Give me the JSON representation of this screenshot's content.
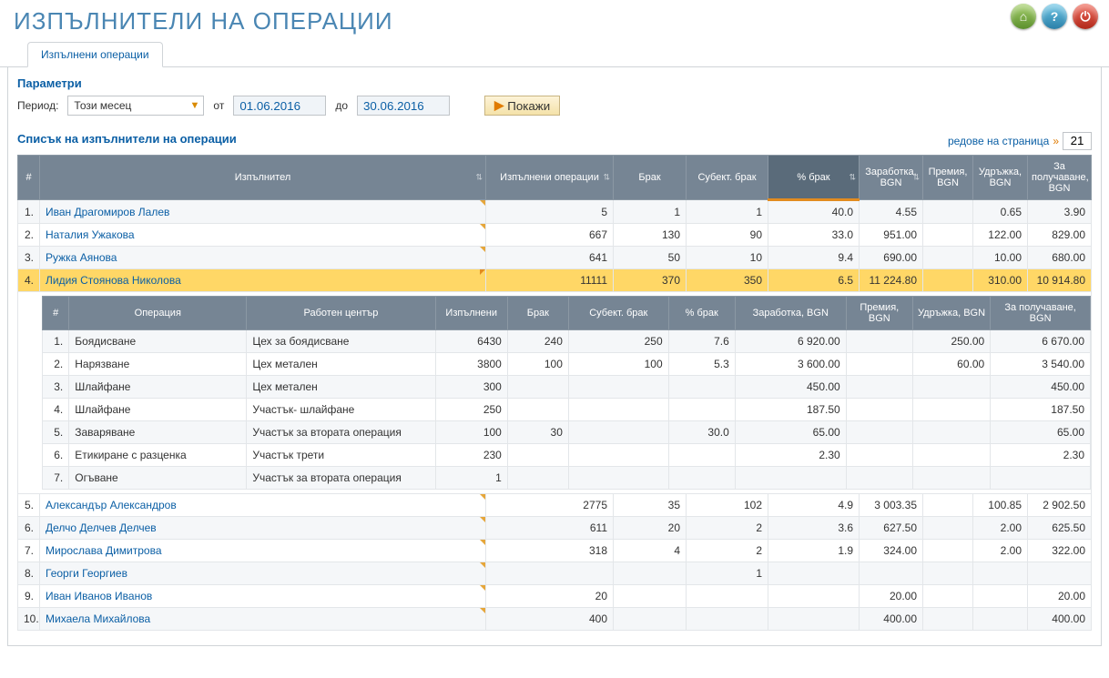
{
  "header": {
    "title": "ИЗПЪЛНИТЕЛИ НА ОПЕРАЦИИ",
    "tab": "Изпълнени операции"
  },
  "params": {
    "section_title": "Параметри",
    "period_label": "Период:",
    "period_value": "Този месец",
    "from_label": "от",
    "from_value": "01.06.2016",
    "to_label": "до",
    "to_value": "30.06.2016",
    "show_label": "Покажи"
  },
  "list": {
    "title": "Списък на изпълнители на операции",
    "rpp_label": "редове на страница",
    "rpp_value": "21"
  },
  "columns": {
    "idx": "#",
    "performer": "Изпълнител",
    "done": "Изпълнени операции",
    "scrap": "Брак",
    "subj_scrap": "Субект. брак",
    "pct_scrap": "% брак",
    "earn": "Заработка, BGN",
    "bonus": "Премия, BGN",
    "deduct": "Удръжка, BGN",
    "receive": "За получаване, BGN"
  },
  "rows": [
    {
      "idx": "1.",
      "name": "Иван Драгомиров Лалев",
      "done": "5",
      "scrap": "1",
      "subj": "1",
      "pct": "40.0",
      "earn": "4.55",
      "bonus": "",
      "deduct": "0.65",
      "recv": "3.90"
    },
    {
      "idx": "2.",
      "name": "Наталия Ужакова",
      "done": "667",
      "scrap": "130",
      "subj": "90",
      "pct": "33.0",
      "earn": "951.00",
      "bonus": "",
      "deduct": "122.00",
      "recv": "829.00"
    },
    {
      "idx": "3.",
      "name": "Ружка Аянова",
      "done": "641",
      "scrap": "50",
      "subj": "10",
      "pct": "9.4",
      "earn": "690.00",
      "bonus": "",
      "deduct": "10.00",
      "recv": "680.00"
    },
    {
      "idx": "4.",
      "name": "Лидия Стоянова Николова",
      "done": "11111",
      "scrap": "370",
      "subj": "350",
      "pct": "6.5",
      "earn": "11 224.80",
      "bonus": "",
      "deduct": "310.00",
      "recv": "10 914.80",
      "expanded": true
    },
    {
      "idx": "5.",
      "name": "Александър Александров",
      "done": "2775",
      "scrap": "35",
      "subj": "102",
      "pct": "4.9",
      "earn": "3 003.35",
      "bonus": "",
      "deduct": "100.85",
      "recv": "2 902.50"
    },
    {
      "idx": "6.",
      "name": "Делчо Делчев Делчев",
      "done": "611",
      "scrap": "20",
      "subj": "2",
      "pct": "3.6",
      "earn": "627.50",
      "bonus": "",
      "deduct": "2.00",
      "recv": "625.50"
    },
    {
      "idx": "7.",
      "name": "Мирослава Димитрова",
      "done": "318",
      "scrap": "4",
      "subj": "2",
      "pct": "1.9",
      "earn": "324.00",
      "bonus": "",
      "deduct": "2.00",
      "recv": "322.00"
    },
    {
      "idx": "8.",
      "name": "Георги Георгиев",
      "done": "",
      "scrap": "",
      "subj": "1",
      "pct": "",
      "earn": "",
      "bonus": "",
      "deduct": "",
      "recv": ""
    },
    {
      "idx": "9.",
      "name": "Иван Иванов Иванов",
      "done": "20",
      "scrap": "",
      "subj": "",
      "pct": "",
      "earn": "20.00",
      "bonus": "",
      "deduct": "",
      "recv": "20.00"
    },
    {
      "idx": "10.",
      "name": "Михаела Михайлова",
      "done": "400",
      "scrap": "",
      "subj": "",
      "pct": "",
      "earn": "400.00",
      "bonus": "",
      "deduct": "",
      "recv": "400.00"
    }
  ],
  "sub_columns": {
    "idx": "#",
    "op": "Операция",
    "wc": "Работен център",
    "done": "Изпълнени",
    "scrap": "Брак",
    "subj": "Субект. брак",
    "pct": "% брак",
    "earn": "Заработка, BGN",
    "bonus": "Премия, BGN",
    "deduct": "Удръжка, BGN",
    "recv": "За получаване, BGN"
  },
  "sub_rows": [
    {
      "idx": "1.",
      "op": "Боядисване",
      "wc": "Цех за боядисване",
      "done": "6430",
      "scrap": "240",
      "subj": "250",
      "pct": "7.6",
      "earn": "6 920.00",
      "bonus": "",
      "deduct": "250.00",
      "recv": "6 670.00"
    },
    {
      "idx": "2.",
      "op": "Нарязване",
      "wc": "Цех метален",
      "done": "3800",
      "scrap": "100",
      "subj": "100",
      "pct": "5.3",
      "earn": "3 600.00",
      "bonus": "",
      "deduct": "60.00",
      "recv": "3 540.00"
    },
    {
      "idx": "3.",
      "op": "Шлайфане",
      "wc": "Цех метален",
      "done": "300",
      "scrap": "",
      "subj": "",
      "pct": "",
      "earn": "450.00",
      "bonus": "",
      "deduct": "",
      "recv": "450.00"
    },
    {
      "idx": "4.",
      "op": "Шлайфане",
      "wc": "Участък- шлайфане",
      "done": "250",
      "scrap": "",
      "subj": "",
      "pct": "",
      "earn": "187.50",
      "bonus": "",
      "deduct": "",
      "recv": "187.50"
    },
    {
      "idx": "5.",
      "op": "Заваряване",
      "wc": "Участък за втората операция",
      "done": "100",
      "scrap": "30",
      "subj": "",
      "pct": "30.0",
      "earn": "65.00",
      "bonus": "",
      "deduct": "",
      "recv": "65.00"
    },
    {
      "idx": "6.",
      "op": "Етикиране с разценка",
      "wc": "Участък трети",
      "done": "230",
      "scrap": "",
      "subj": "",
      "pct": "",
      "earn": "2.30",
      "bonus": "",
      "deduct": "",
      "recv": "2.30"
    },
    {
      "idx": "7.",
      "op": "Огъване",
      "wc": "Участък за втората операция",
      "done": "1",
      "scrap": "",
      "subj": "",
      "pct": "",
      "earn": "",
      "bonus": "",
      "deduct": "",
      "recv": ""
    }
  ]
}
